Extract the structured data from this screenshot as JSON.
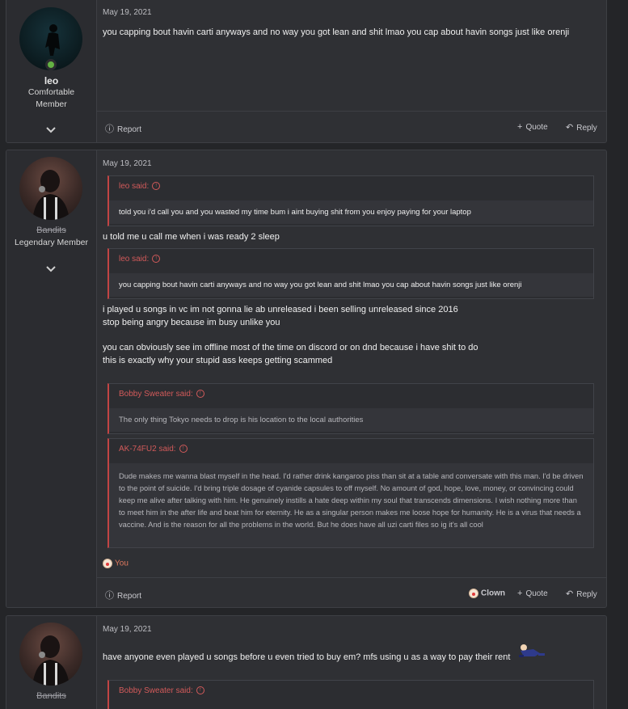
{
  "posts": [
    {
      "author": "leo",
      "user_title": [
        "Comfortable",
        "Member"
      ],
      "date": "May 19, 2021",
      "message": "you capping bout havin carti anyways and no way you got lean and shit lmao you cap about havin songs just like orenji",
      "actions": {
        "report": "Report",
        "quote": "Quote",
        "reply": "Reply"
      }
    },
    {
      "author": "Bandits",
      "user_title": [
        "Legendary Member"
      ],
      "date": "May 19, 2021",
      "quotes": [
        {
          "author": "leo said:",
          "text": "told you i'd call you and you wasted my time bum i aint buying shit from you enjoy paying for your laptop"
        },
        {
          "author": "leo said:",
          "text": "you capping bout havin carti anyways and no way you got lean and shit lmao you cap about havin songs just like orenji"
        },
        {
          "author": "Bobby Sweater said:",
          "text": "The only thing Tokyo needs to drop is his location to the local authorities"
        },
        {
          "author": "AK-74FU2 said:",
          "text": "Dude makes me wanna blast myself in the head. I'd rather drink kangaroo piss than sit at a table and conversate with this man. I'd be driven to the point of suicide. I'd bring triple dosage of cyanide capsules to off myself. No amount of god, hope, love, money, or convincing could keep me alive after talking with him. He genuinely instills a hate deep within my soul that transcends dimensions. I wish nothing more than to meet him in the after life and beat him for eternity. He as a singular person makes me loose hope for humanity. He is a virus that needs a vaccine. And is the reason for all the problems in the world. But he does have all uzi carti files so ig it's all cool"
        }
      ],
      "lines": [
        "u told me u call me when i was ready 2 sleep",
        "i played u songs in vc im not gonna lie ab unreleased i been selling unreleased since 2016",
        "stop being angry because im busy unlike you",
        "you can obviously see im offline most of the time on discord or on dnd because i have shit to do",
        "this is exactly why your stupid ass keeps getting scammed"
      ],
      "reaction": "You",
      "actions": {
        "report": "Report",
        "clown": "Clown",
        "quote": "Quote",
        "reply": "Reply"
      }
    },
    {
      "author": "Bandits",
      "date": "May 19, 2021",
      "message": "have anyone even played u songs before u even tried to buy em? mfs using u as a way to pay their rent",
      "quotes": [
        {
          "author": "Bobby Sweater said:"
        }
      ]
    }
  ],
  "colors": {
    "accent": "#d25a5a",
    "online": "#63b243",
    "panel": "#2f3034"
  }
}
